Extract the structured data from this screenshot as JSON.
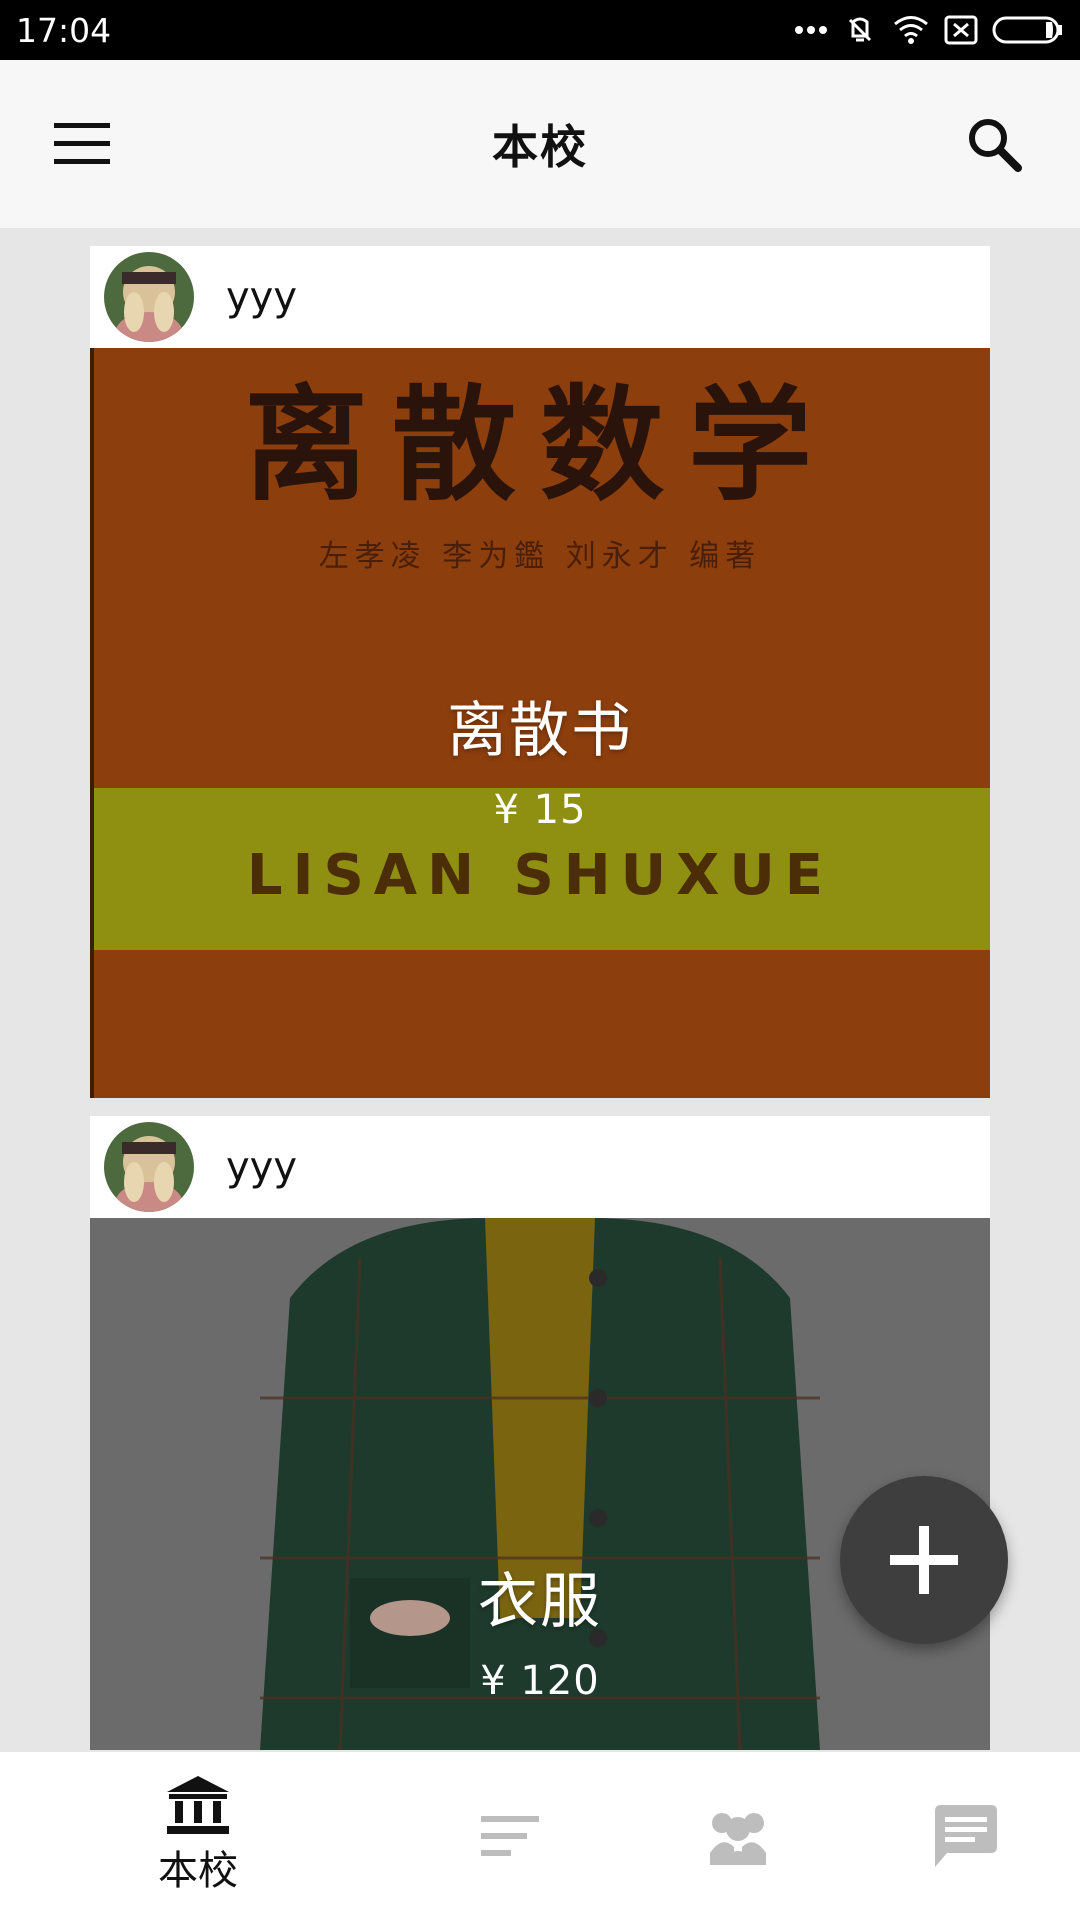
{
  "status_bar": {
    "time": "17:04",
    "icons": [
      "more-dots-icon",
      "vibrate-off-icon",
      "wifi-icon",
      "no-sim-icon",
      "battery-icon"
    ]
  },
  "app_bar": {
    "title": "本校",
    "menu_icon": "menu-icon",
    "search_icon": "search-icon"
  },
  "feed": {
    "items": [
      {
        "user_name": "yyy",
        "title": "离散书",
        "price": "¥ 15",
        "book_cover": {
          "title": "离散数学",
          "authors": "左孝凌 李为鑑 刘永才 编著",
          "band_text": "LISAN SHUXUE"
        }
      },
      {
        "user_name": "yyy",
        "title": "衣服",
        "price": "¥ 120"
      }
    ]
  },
  "fab": {
    "icon": "plus-icon"
  },
  "bottom_nav": {
    "items": [
      {
        "label": "本校",
        "icon": "school-icon",
        "active": true
      },
      {
        "label": "",
        "icon": "list-icon",
        "active": false
      },
      {
        "label": "",
        "icon": "people-icon",
        "active": false
      },
      {
        "label": "",
        "icon": "message-icon",
        "active": false
      }
    ]
  },
  "colors": {
    "status_bar": "#000000",
    "app_bar": "#f7f7f7",
    "background": "#e6e6e6",
    "fab": "#3e3e3e",
    "nav_active": "#111111",
    "nav_inactive": "#bdbdbd"
  }
}
